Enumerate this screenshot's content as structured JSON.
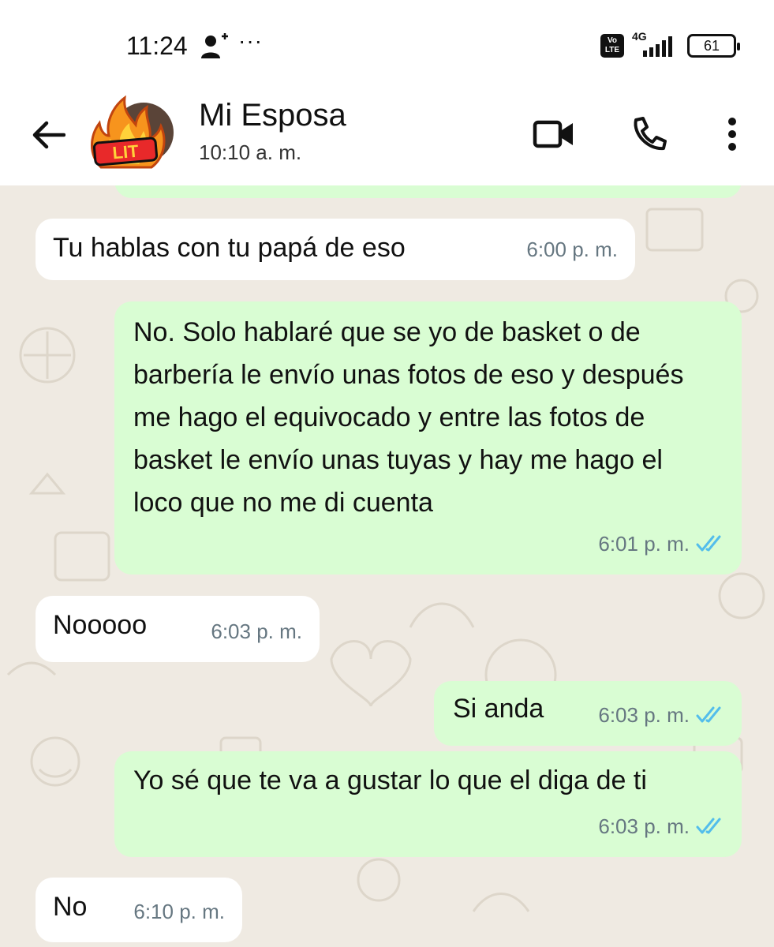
{
  "status_bar": {
    "time": "11:24",
    "extra_icons": "person-add-icon",
    "dots": "···",
    "volte_label": "Vo LTE",
    "network": "4G",
    "battery": "61"
  },
  "header": {
    "contact_name": "Mi Esposa",
    "last_seen": "10:10 a. m.",
    "avatar_sticker_text": "LIT"
  },
  "colors": {
    "chat_bg": "#efeae2",
    "incoming_bubble": "#ffffff",
    "outgoing_bubble": "#d9fdd3",
    "read_ticks": "#53bdeb",
    "timestamp": "#667781"
  },
  "messages": [
    {
      "direction": "in",
      "text": "Tu hablas con tu papá de eso",
      "time": "6:00 p. m."
    },
    {
      "direction": "out",
      "text": "No. Solo hablaré que se yo de basket o de barbería le envío unas fotos de eso y después me hago el equivocado y entre las fotos de basket le envío unas tuyas y hay me hago el loco que no me di cuenta",
      "time": "6:01 p. m.",
      "read": true
    },
    {
      "direction": "in",
      "text": "Nooooo",
      "time": "6:03 p. m."
    },
    {
      "direction": "out",
      "text": "Si anda",
      "time": "6:03 p. m.",
      "read": true
    },
    {
      "direction": "out",
      "text": "Yo sé que te va a gustar lo que el diga de ti",
      "time": "6:03 p. m.",
      "read": true
    },
    {
      "direction": "in",
      "text": "No",
      "time": "6:10 p. m."
    }
  ]
}
